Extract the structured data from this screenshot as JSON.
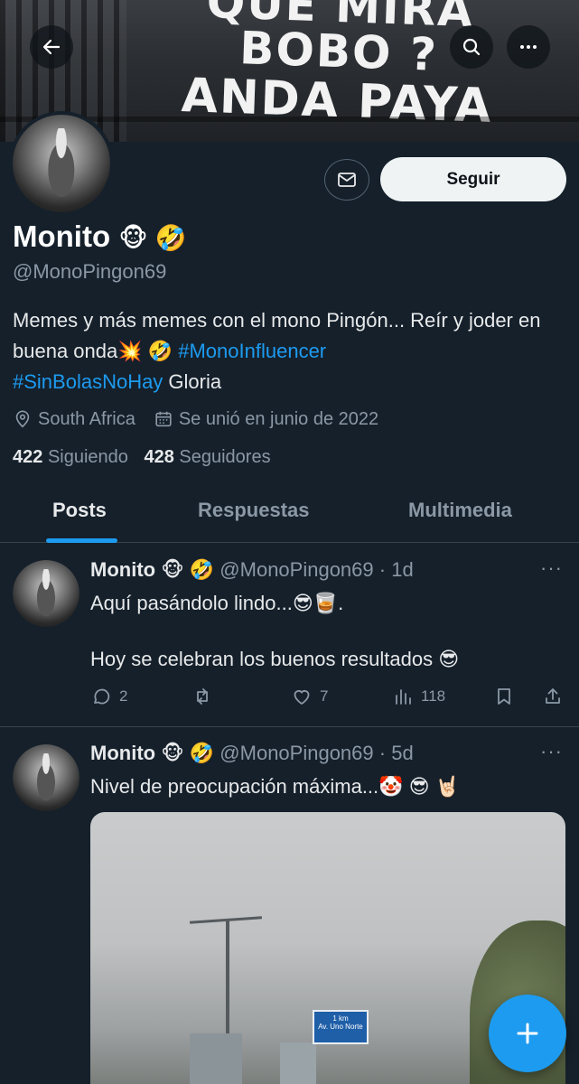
{
  "banner": {
    "graffiti_line1": "QUE MIRA BOBO ?",
    "graffiti_line2": "ANDA PAYA"
  },
  "profile": {
    "name": "Monito",
    "name_emoji": "🐵 🤣",
    "handle": "@MonoPingon69",
    "follow_label": "Seguir",
    "bio": {
      "line1": "Memes y más memes con el mono Pingón... Reír y joder en buena onda💥 🤣 ",
      "hashtag1": "#MonoInfluencer",
      "hashtag2": "#SinBolasNoHay",
      "tail": " Gloria"
    },
    "location": "South Africa",
    "joined": "Se unió en junio de 2022",
    "following_count": "422",
    "following_label": "Siguiendo",
    "followers_count": "428",
    "followers_label": "Seguidores"
  },
  "tabs": [
    {
      "label": "Posts",
      "active": true
    },
    {
      "label": "Respuestas",
      "active": false
    },
    {
      "label": "Multimedia",
      "active": false
    }
  ],
  "posts": [
    {
      "name": "Monito",
      "emoji": "🐵 🤣",
      "handle": "@MonoPingon69",
      "time": "· 1d",
      "text1": "Aquí pasándolo lindo...😎🥃.",
      "text2": "Hoy se celebran los buenos resultados 😎",
      "replies": "2",
      "retweets": "",
      "likes": "7",
      "views": "118"
    },
    {
      "name": "Monito",
      "emoji": "🐵 🤣",
      "handle": "@MonoPingon69",
      "time": "· 5d",
      "text1": "Nivel de preocupación máxima...🤡 😎 🤘🏻",
      "media_sign_line1": "1 km",
      "media_sign_line2": "Av. Uno Norte"
    }
  ],
  "icons": {
    "back": "arrow-left-icon",
    "search": "search-icon",
    "more": "more-icon",
    "message": "envelope-icon",
    "location": "location-pin-icon",
    "calendar": "calendar-icon",
    "compose": "plus-icon"
  },
  "colors": {
    "background": "#15202b",
    "accent": "#1d9bf0",
    "muted": "#8b98a5"
  }
}
